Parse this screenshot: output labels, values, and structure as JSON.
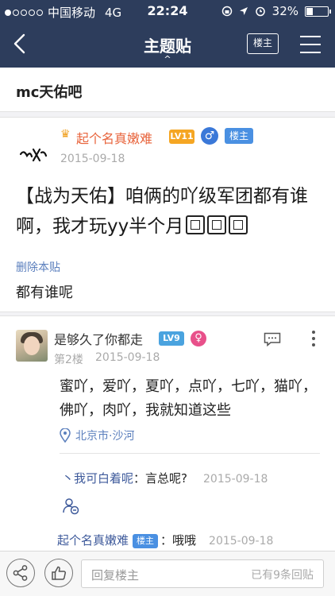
{
  "status_bar": {
    "carrier": "中国移动",
    "network": "4G",
    "time": "22:24",
    "battery": "32%",
    "battery_level": 0.32,
    "signal_dots_filled": 1,
    "signal_dots_total": 5
  },
  "nav": {
    "back_icon": "chevron-left-icon",
    "title": "主题贴",
    "caret": "^",
    "louzhu_button": "楼主",
    "menu_icon": "hamburger-menu-icon"
  },
  "forum": {
    "name": "mc天佑吧"
  },
  "main_post": {
    "crown_icon": "crown-icon",
    "username": "起个名真嫩难",
    "level": "LV11",
    "gender_symbol": "♂",
    "role_badge": "楼主",
    "date": "2015-09-18",
    "title": "【战为天佑】咱俩的吖级军团都有谁啊，我才玩yy半个月",
    "delete_link": "删除本贴",
    "body": "都有谁呢",
    "colors": {
      "username": "#e8643c",
      "level_badge": "#f5a623",
      "male": "#3a78d8",
      "role_badge": "#4a90e2",
      "link": "#5b7fbd"
    }
  },
  "reply": {
    "username": "是够久了你都走",
    "level": "LV9",
    "gender_symbol": "♀",
    "floor": "第2楼",
    "date": "2015-09-18",
    "content": "蜜吖，爱吖，夏吖，点吖，七吖，猫吖，佛吖，肉吖，我就知道这些",
    "location": "北京市·沙河",
    "location_icon": "location-pin-icon",
    "comment_icon": "comment-icon",
    "more_icon": "more-vertical-icon",
    "sub_replies": [
      {
        "prefix": "丶",
        "user": "我可白着呢",
        "sep": "：",
        "text": "言总呢?",
        "date": "2015-09-18"
      },
      {
        "user": "起个名真嫩难",
        "badge": "楼主",
        "sep": "：",
        "text": "哦哦",
        "date": "2015-09-18"
      }
    ],
    "subreply_icon": "add-user-icon",
    "colors": {
      "level_badge": "#4aa3df",
      "female": "#e8508a",
      "sub_user": "#3e5a9b"
    }
  },
  "bottom_bar": {
    "share_icon": "share-icon",
    "like_icon": "thumbs-up-icon",
    "reply_placeholder": "回复楼主",
    "reply_count": "已有9条回贴"
  }
}
